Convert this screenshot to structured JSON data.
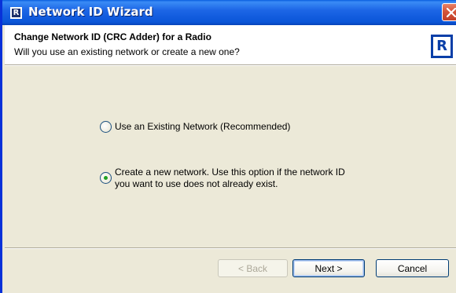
{
  "window": {
    "title": "Network ID Wizard",
    "icon_glyph": "R"
  },
  "header": {
    "title": "Change Network ID (CRC Adder) for a Radio",
    "subtitle": "Will you use an existing network or create a new one?",
    "logo_glyph": "R"
  },
  "options": [
    {
      "label": "Use an Existing Network (Recommended)",
      "checked": false
    },
    {
      "label": "Create a new network.  Use this option if the network ID\nyou want to use does not already exist.",
      "checked": true
    }
  ],
  "buttons": {
    "back_label": "< Back",
    "next_label": "Next >",
    "cancel_label": "Cancel"
  }
}
